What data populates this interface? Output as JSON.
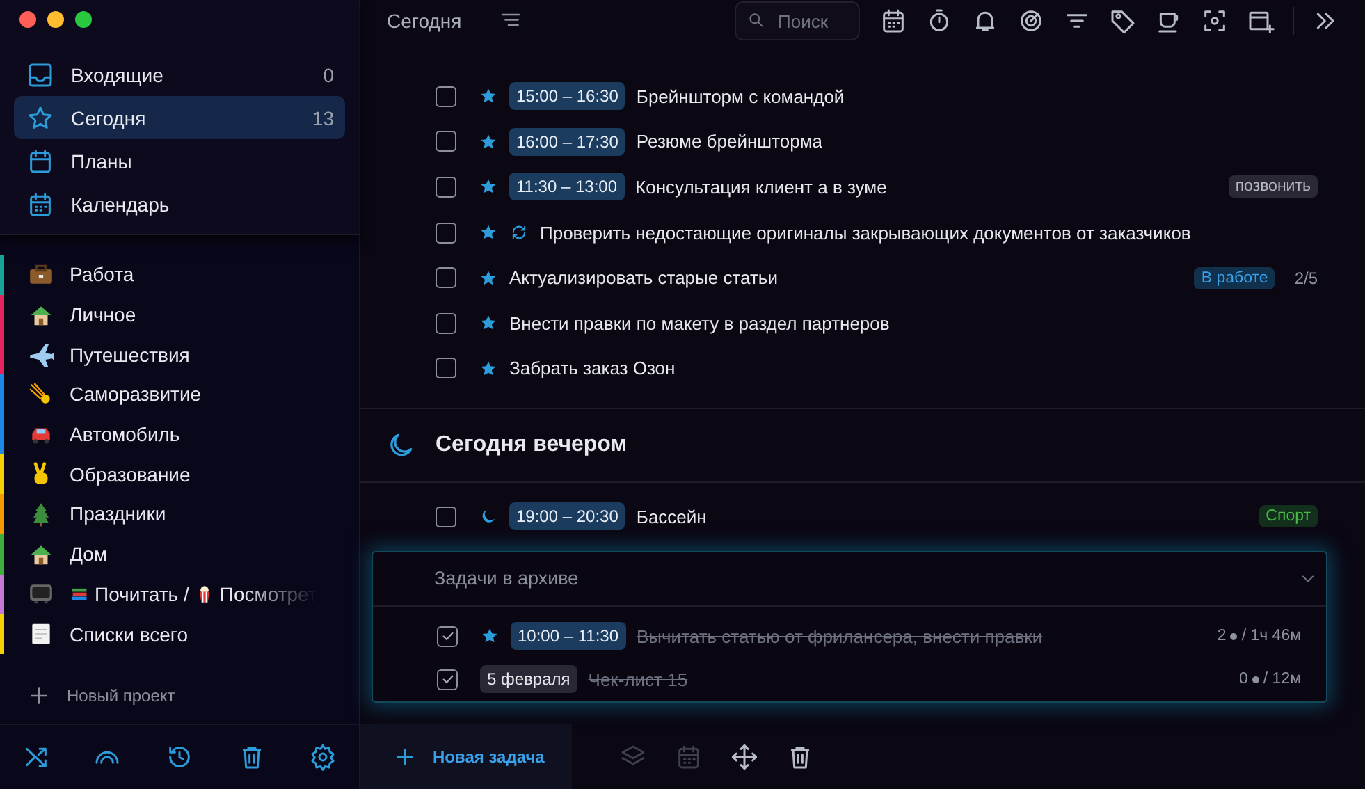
{
  "sidebar": {
    "nav": [
      {
        "label": "Входящие",
        "count": "0",
        "selected": false
      },
      {
        "label": "Сегодня",
        "count": "13",
        "selected": true
      },
      {
        "label": "Планы",
        "selected": false
      },
      {
        "label": "Календарь",
        "selected": false
      }
    ],
    "projects": [
      {
        "label": "Работа",
        "color": "#17a398"
      },
      {
        "label": "Личное",
        "color": "#e3245f"
      },
      {
        "label": "Путешествия",
        "color": "#e3245f"
      },
      {
        "label": "Саморазвитие",
        "color": "#1e88e5"
      },
      {
        "label": "Автомобиль",
        "color": "#1e88e5"
      },
      {
        "label": "Образование",
        "color": "#f5d000"
      },
      {
        "label": "Праздники",
        "color": "#f59a00"
      },
      {
        "label": "Дом",
        "color": "#3fae3f"
      },
      {
        "parts": [
          "Почитать /",
          "Посмотрет"
        ],
        "color": "#c777d6"
      },
      {
        "label": "Списки всего",
        "color": "#f5d000"
      }
    ],
    "new_project": "Новый проект"
  },
  "header": {
    "title": "Сегодня",
    "search": {
      "placeholder": "Поиск"
    }
  },
  "tasks": [
    {
      "checked": false,
      "kind": "star",
      "time": "15:00 – 16:30",
      "title": "Брейншторм с командой"
    },
    {
      "checked": false,
      "kind": "star",
      "time": "16:00 – 17:30",
      "title": "Резюме брейншторма"
    },
    {
      "checked": false,
      "kind": "star",
      "time": "11:30 – 13:00",
      "title": "Консультация клиент а в зуме",
      "tag": {
        "text": "позвонить",
        "kind": "grey"
      }
    },
    {
      "checked": false,
      "kind": "star",
      "repeat": true,
      "title": "Проверить недостающие оригиналы закрывающих документов от заказчиков"
    },
    {
      "checked": false,
      "kind": "star",
      "title": "Актуализировать старые статьи",
      "tag": {
        "text": "В работе",
        "kind": "blue"
      },
      "count": "2/5"
    },
    {
      "checked": false,
      "kind": "star",
      "title": "Внести правки по макету в раздел партнеров"
    },
    {
      "checked": false,
      "kind": "star",
      "title": "Забрать заказ Озон"
    }
  ],
  "evening": {
    "title": "Сегодня вечером",
    "tasks": [
      {
        "checked": false,
        "kind": "moon",
        "time": "19:00 – 20:30",
        "title": "Бассейн",
        "tag": {
          "text": "Спорт",
          "kind": "green"
        }
      }
    ]
  },
  "archive": {
    "title": "Задачи в архиве",
    "tasks": [
      {
        "checked": true,
        "kind": "star",
        "time": "10:00 – 11:30",
        "title": "Вычитать статью от фрилансера, внести правки",
        "meta": [
          "2",
          "/ 1ч 46м"
        ]
      },
      {
        "checked": true,
        "kind": "plain",
        "date": "5 февраля",
        "title": "Чек-лист 15",
        "meta": [
          "0",
          "/ 12м"
        ]
      }
    ]
  },
  "bottom_bar": {
    "new_task": "Новая задача"
  }
}
